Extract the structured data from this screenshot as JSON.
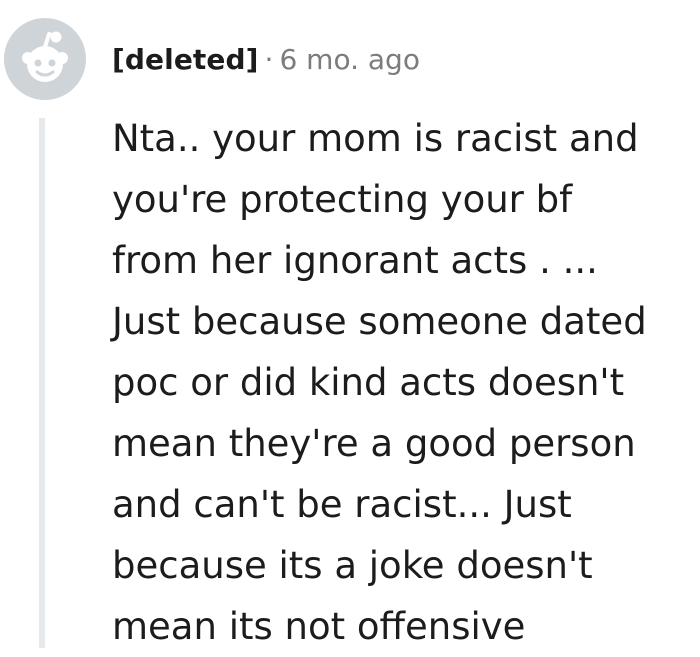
{
  "comment": {
    "author": "[deleted]",
    "separator": "·",
    "timestamp": "6 mo. ago",
    "avatar_icon": "reddit-snoo-avatar-icon",
    "body_lines": [
      "Nta.. your mom is racist and",
      "you're protecting your bf",
      "from her ignorant acts . ...",
      "Just because someone dated",
      "poc or did kind acts doesn't",
      "mean they're a good person",
      "and can't be racist... Just",
      "because its a joke doesn't",
      "mean its not offensive"
    ]
  },
  "colors": {
    "text": "#1c1c1c",
    "meta": "#7c7c7c",
    "avatar": "#cfd4d9",
    "thread_line": "#e6e9ec"
  }
}
